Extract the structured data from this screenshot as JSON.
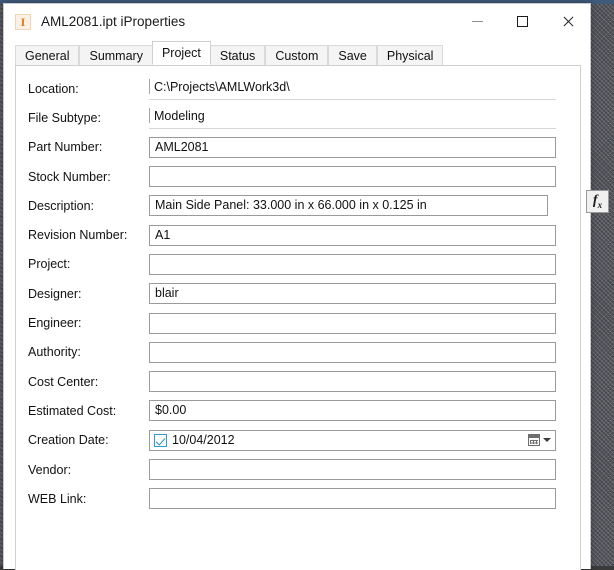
{
  "window": {
    "title": "AML2081.ipt iProperties",
    "icon": "inventor-part-icon",
    "controls": {
      "minimize": "minimize-icon",
      "maximize": "maximize-icon",
      "close": "close-icon"
    }
  },
  "tabs": [
    {
      "label": "General",
      "active": false
    },
    {
      "label": "Summary",
      "active": false
    },
    {
      "label": "Project",
      "active": true
    },
    {
      "label": "Status",
      "active": false
    },
    {
      "label": "Custom",
      "active": false
    },
    {
      "label": "Save",
      "active": false
    },
    {
      "label": "Physical",
      "active": false
    }
  ],
  "fields": [
    {
      "label": "Location:",
      "value": "C:\\Projects\\AMLWork3d\\",
      "readonly": true
    },
    {
      "label": "File Subtype:",
      "value": "Modeling",
      "readonly": true
    },
    {
      "label": "Part Number:",
      "value": "AML2081",
      "readonly": false
    },
    {
      "label": "Stock Number:",
      "value": "",
      "readonly": false
    },
    {
      "label": "Description:",
      "value": "Main Side Panel: 33.000 in x 66.000 in x 0.125 in",
      "readonly": false
    },
    {
      "label": "Revision Number:",
      "value": "A1",
      "readonly": false
    },
    {
      "label": "Project:",
      "value": "",
      "readonly": false
    },
    {
      "label": "Designer:",
      "value": "blair",
      "readonly": false
    },
    {
      "label": "Engineer:",
      "value": "",
      "readonly": false
    },
    {
      "label": "Authority:",
      "value": "",
      "readonly": false
    },
    {
      "label": "Cost Center:",
      "value": "",
      "readonly": false
    },
    {
      "label": "Estimated Cost:",
      "value": "$0.00",
      "readonly": false
    },
    {
      "label": "Vendor:",
      "value": "",
      "readonly": false
    },
    {
      "label": "WEB Link:",
      "value": "",
      "readonly": false
    }
  ],
  "description_formula_button": {
    "label": "fx",
    "icon": "function-fx-icon"
  },
  "creation_date": {
    "label": "Creation Date:",
    "value": "10/04/2012",
    "checked": true,
    "calendar_icon": "calendar-icon",
    "dropdown_icon": "chevron-down-icon"
  },
  "colors": {
    "accent_checkbox": "#3399cc",
    "icon_orange": "#e07b1f",
    "field_border": "#9a9a9a",
    "panel_border": "#d0d0d0"
  }
}
